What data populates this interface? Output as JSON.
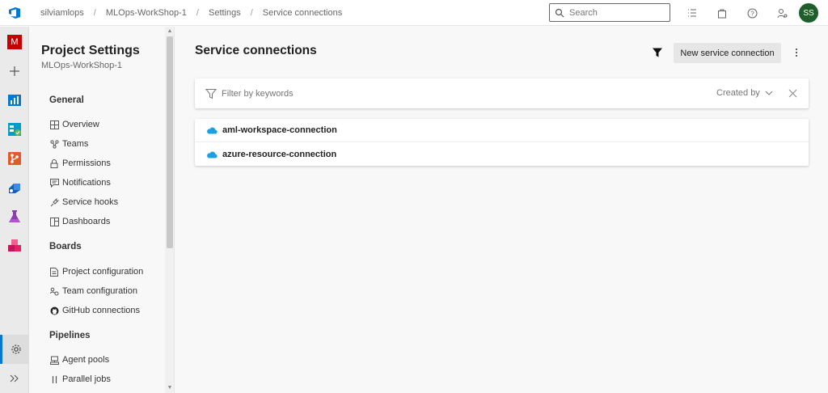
{
  "breadcrumb": {
    "items": [
      "silviamlops",
      "MLOps-WorkShop-1",
      "Settings",
      "Service connections"
    ],
    "separator": "/"
  },
  "search": {
    "placeholder": "Search"
  },
  "user": {
    "initials": "SS"
  },
  "rail": {
    "project_initial": "M"
  },
  "nav": {
    "title": "Project Settings",
    "subtitle": "MLOps-WorkShop-1",
    "sections": [
      {
        "title": "General",
        "items": [
          "Overview",
          "Teams",
          "Permissions",
          "Notifications",
          "Service hooks",
          "Dashboards"
        ]
      },
      {
        "title": "Boards",
        "items": [
          "Project configuration",
          "Team configuration",
          "GitHub connections"
        ]
      },
      {
        "title": "Pipelines",
        "items": [
          "Agent pools",
          "Parallel jobs"
        ]
      }
    ]
  },
  "main": {
    "title": "Service connections",
    "new_button": "New service connection",
    "filter": {
      "placeholder": "Filter by keywords",
      "created_by": "Created by"
    },
    "connections": [
      "aml-workspace-connection",
      "azure-resource-connection"
    ]
  },
  "colors": {
    "accent": "#0078d4",
    "avatar_bg": "#1e5e2b",
    "project_tile": "#c40000",
    "cloud": "#1ba1e2"
  }
}
